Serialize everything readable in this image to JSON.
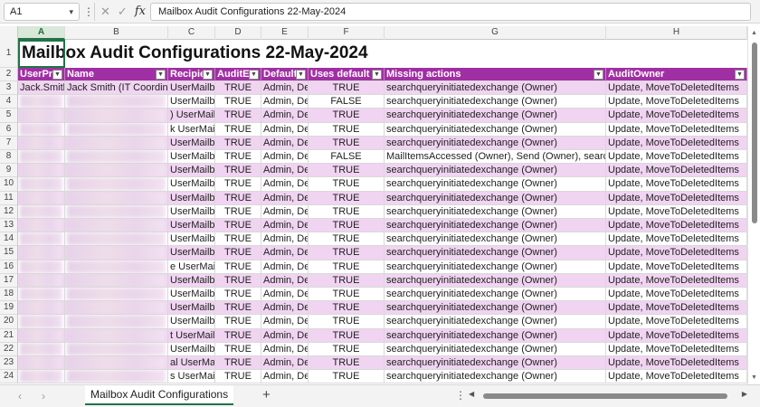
{
  "formula_bar": {
    "name_box": "A1",
    "formula": "Mailbox Audit Configurations 22-May-2024"
  },
  "columns": [
    "A",
    "B",
    "C",
    "D",
    "E",
    "F",
    "G",
    "H"
  ],
  "selected_column": "A",
  "title": "Mailbox Audit Configurations 22-May-2024",
  "table": {
    "headers": [
      "UserPr",
      "Name",
      "Recipie",
      "AuditEr",
      "Default",
      "Uses default a",
      "Missing actions",
      "AuditOwner"
    ],
    "rows": [
      {
        "num": "3",
        "a": "Jack.Smith",
        "b": "Jack Smith (IT Coordina",
        "c": "UserMailb",
        "d": "TRUE",
        "e": "Admin, De",
        "f": "TRUE",
        "g": "searchqueryinitiatedexchange (Owner)",
        "h": "Update, MoveToDeletedItems"
      },
      {
        "num": "4",
        "a": "",
        "b": "",
        "c": "UserMailb",
        "d": "TRUE",
        "e": "Admin, De",
        "f": "FALSE",
        "g": "searchqueryinitiatedexchange (Owner)",
        "h": "Update, MoveToDeletedItems"
      },
      {
        "num": "5",
        "a": "",
        "b": "",
        "c": ") UserMailb",
        "d": "TRUE",
        "e": "Admin, De",
        "f": "TRUE",
        "g": "searchqueryinitiatedexchange (Owner)",
        "h": "Update, MoveToDeletedItems"
      },
      {
        "num": "6",
        "a": "",
        "b": "",
        "c": "k UserMailb",
        "d": "TRUE",
        "e": "Admin, De",
        "f": "TRUE",
        "g": "searchqueryinitiatedexchange (Owner)",
        "h": "Update, MoveToDeletedItems"
      },
      {
        "num": "7",
        "a": "",
        "b": "",
        "c": "UserMailb",
        "d": "TRUE",
        "e": "Admin, De",
        "f": "TRUE",
        "g": "searchqueryinitiatedexchange (Owner)",
        "h": "Update, MoveToDeletedItems"
      },
      {
        "num": "8",
        "a": "",
        "b": "",
        "c": "UserMailb",
        "d": "TRUE",
        "e": "Admin, De",
        "f": "FALSE",
        "g": "MailItemsAccessed (Owner), Send (Owner), searc",
        "h": "Update, MoveToDeletedItems"
      },
      {
        "num": "9",
        "a": "",
        "b": "",
        "c": "UserMailb",
        "d": "TRUE",
        "e": "Admin, De",
        "f": "TRUE",
        "g": "searchqueryinitiatedexchange (Owner)",
        "h": "Update, MoveToDeletedItems"
      },
      {
        "num": "10",
        "a": "",
        "b": "",
        "c": "UserMailb",
        "d": "TRUE",
        "e": "Admin, De",
        "f": "TRUE",
        "g": "searchqueryinitiatedexchange (Owner)",
        "h": "Update, MoveToDeletedItems"
      },
      {
        "num": "11",
        "a": "",
        "b": "",
        "c": "UserMailb",
        "d": "TRUE",
        "e": "Admin, De",
        "f": "TRUE",
        "g": "searchqueryinitiatedexchange (Owner)",
        "h": "Update, MoveToDeletedItems"
      },
      {
        "num": "12",
        "a": "",
        "b": "",
        "c": "UserMailb",
        "d": "TRUE",
        "e": "Admin, De",
        "f": "TRUE",
        "g": "searchqueryinitiatedexchange (Owner)",
        "h": "Update, MoveToDeletedItems"
      },
      {
        "num": "13",
        "a": "",
        "b": "",
        "c": "UserMailb",
        "d": "TRUE",
        "e": "Admin, De",
        "f": "TRUE",
        "g": "searchqueryinitiatedexchange (Owner)",
        "h": "Update, MoveToDeletedItems"
      },
      {
        "num": "14",
        "a": "",
        "b": "",
        "c": "UserMailb",
        "d": "TRUE",
        "e": "Admin, De",
        "f": "TRUE",
        "g": "searchqueryinitiatedexchange (Owner)",
        "h": "Update, MoveToDeletedItems"
      },
      {
        "num": "15",
        "a": "",
        "b": "",
        "c": "UserMailb",
        "d": "TRUE",
        "e": "Admin, De",
        "f": "TRUE",
        "g": "searchqueryinitiatedexchange (Owner)",
        "h": "Update, MoveToDeletedItems"
      },
      {
        "num": "16",
        "a": "",
        "b": "",
        "c": "e UserMailb",
        "d": "TRUE",
        "e": "Admin, De",
        "f": "TRUE",
        "g": "searchqueryinitiatedexchange (Owner)",
        "h": "Update, MoveToDeletedItems"
      },
      {
        "num": "17",
        "a": "",
        "b": "",
        "c": "UserMailb",
        "d": "TRUE",
        "e": "Admin, De",
        "f": "TRUE",
        "g": "searchqueryinitiatedexchange (Owner)",
        "h": "Update, MoveToDeletedItems"
      },
      {
        "num": "18",
        "a": "",
        "b": "",
        "c": "UserMailb",
        "d": "TRUE",
        "e": "Admin, De",
        "f": "TRUE",
        "g": "searchqueryinitiatedexchange (Owner)",
        "h": "Update, MoveToDeletedItems"
      },
      {
        "num": "19",
        "a": "",
        "b": "",
        "c": "UserMailb",
        "d": "TRUE",
        "e": "Admin, De",
        "f": "TRUE",
        "g": "searchqueryinitiatedexchange (Owner)",
        "h": "Update, MoveToDeletedItems"
      },
      {
        "num": "20",
        "a": "",
        "b": "",
        "c": "UserMailb",
        "d": "TRUE",
        "e": "Admin, De",
        "f": "TRUE",
        "g": "searchqueryinitiatedexchange (Owner)",
        "h": "Update, MoveToDeletedItems"
      },
      {
        "num": "21",
        "a": "",
        "b": "",
        "c": "t UserMailb",
        "d": "TRUE",
        "e": "Admin, De",
        "f": "TRUE",
        "g": "searchqueryinitiatedexchange (Owner)",
        "h": "Update, MoveToDeletedItems"
      },
      {
        "num": "22",
        "a": "",
        "b": "",
        "c": "UserMailb",
        "d": "TRUE",
        "e": "Admin, De",
        "f": "TRUE",
        "g": "searchqueryinitiatedexchange (Owner)",
        "h": "Update, MoveToDeletedItems"
      },
      {
        "num": "23",
        "a": "",
        "b": "",
        "c": "al UserMailb",
        "d": "TRUE",
        "e": "Admin, De",
        "f": "TRUE",
        "g": "searchqueryinitiatedexchange (Owner)",
        "h": "Update, MoveToDeletedItems"
      },
      {
        "num": "24",
        "a": "",
        "b": "",
        "c": "s UserMailb",
        "d": "TRUE",
        "e": "Admin, De",
        "f": "TRUE",
        "g": "searchqueryinitiatedexchange (Owner)",
        "h": "Update, MoveToDeletedItems"
      }
    ]
  },
  "sheet_tab": "Mailbox Audit Configurations",
  "icons": {
    "chevron": "▾",
    "kebab": "⋮",
    "cancel": "✕",
    "enter": "✓",
    "fx": "fx",
    "filter": "▼",
    "prev": "‹",
    "next": "›",
    "add": "+",
    "dots": "⋮",
    "left": "◀",
    "right": "▶",
    "up": "▲",
    "down": "▼"
  },
  "colors": {
    "header": "#a12fa4",
    "band": "#f0d4f1",
    "accent": "#217346"
  }
}
